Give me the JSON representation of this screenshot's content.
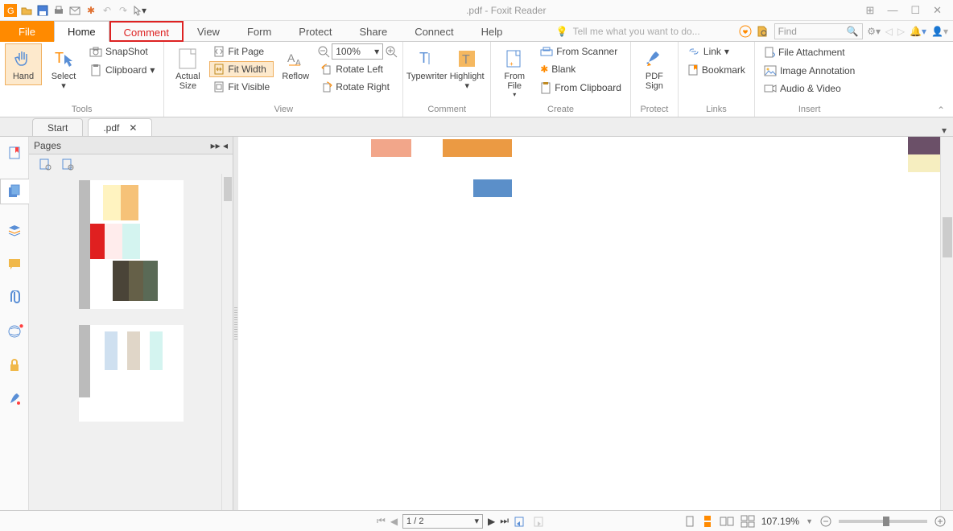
{
  "title": ".pdf - Foxit Reader",
  "tabs": {
    "file": "File",
    "home": "Home",
    "comment": "Comment",
    "view": "View",
    "form": "Form",
    "protect": "Protect",
    "share": "Share",
    "connect": "Connect",
    "help": "Help"
  },
  "tellme": "Tell me what you want to do...",
  "find": "Find",
  "ribbon": {
    "tools": {
      "hand": "Hand",
      "select": "Select",
      "snapshot": "SnapShot",
      "clipboard": "Clipboard",
      "label": "Tools"
    },
    "view": {
      "actual": "Actual\nSize",
      "fitpage": "Fit Page",
      "fitwidth": "Fit Width",
      "fitvisible": "Fit Visible",
      "reflow": "Reflow",
      "zoom": "100%",
      "rotleft": "Rotate Left",
      "rotright": "Rotate Right",
      "label": "View"
    },
    "comment": {
      "typewriter": "Typewriter",
      "highlight": "Highlight",
      "label": "Comment"
    },
    "create": {
      "fromfile": "From\nFile",
      "fromscanner": "From Scanner",
      "blank": "Blank",
      "fromclip": "From Clipboard",
      "label": "Create"
    },
    "protect": {
      "pdfsign": "PDF\nSign",
      "label": "Protect"
    },
    "links": {
      "link": "Link",
      "bookmark": "Bookmark",
      "label": "Links"
    },
    "insert": {
      "file": "File Attachment",
      "image": "Image Annotation",
      "audio": "Audio & Video",
      "label": "Insert"
    }
  },
  "doctabs": {
    "start": "Start",
    "current": ".pdf"
  },
  "pages": {
    "title": "Pages"
  },
  "status": {
    "page": "1 / 2",
    "zoom": "107.19%"
  }
}
